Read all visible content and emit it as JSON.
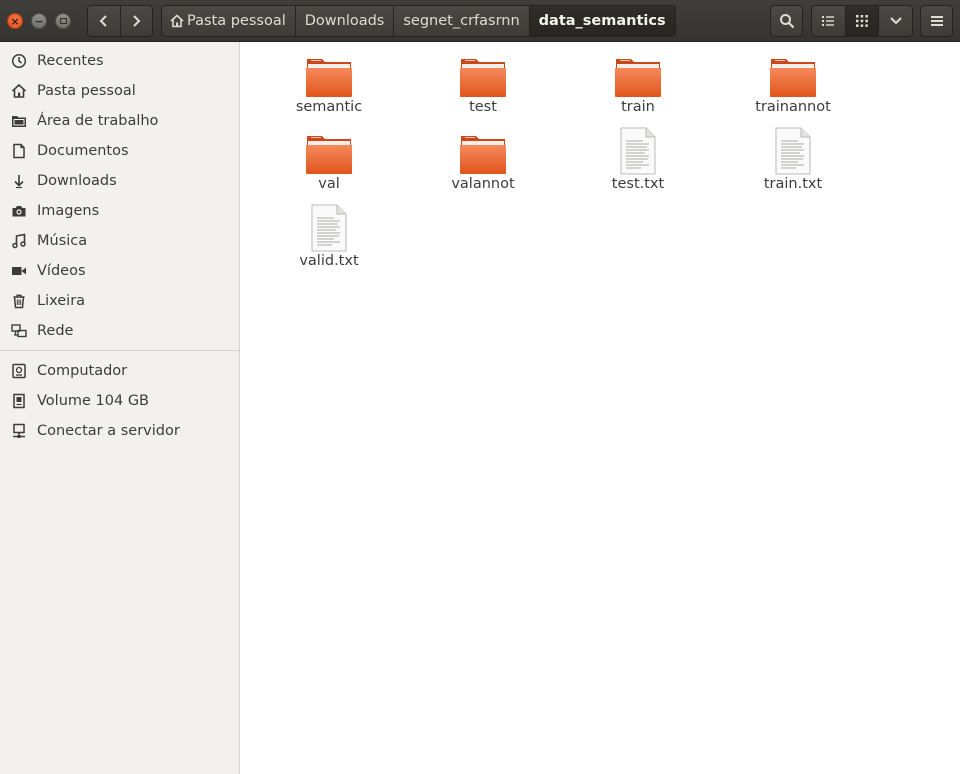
{
  "window": {
    "close_symbol": "×",
    "minimize_symbol": "−"
  },
  "breadcrumb": [
    {
      "label": "Pasta pessoal",
      "icon": "home-icon"
    },
    {
      "label": "Downloads"
    },
    {
      "label": "segnet_crfasrnn"
    },
    {
      "label": "data_semantics",
      "active": true
    }
  ],
  "sidebar": {
    "places": [
      {
        "label": "Recentes",
        "icon": "clock-icon"
      },
      {
        "label": "Pasta pessoal",
        "icon": "home-icon"
      },
      {
        "label": "Área de trabalho",
        "icon": "desktop-folder-icon"
      },
      {
        "label": "Documentos",
        "icon": "document-icon"
      },
      {
        "label": "Downloads",
        "icon": "download-icon"
      },
      {
        "label": "Imagens",
        "icon": "camera-icon"
      },
      {
        "label": "Música",
        "icon": "music-icon"
      },
      {
        "label": "Vídeos",
        "icon": "video-icon"
      },
      {
        "label": "Lixeira",
        "icon": "trash-icon"
      },
      {
        "label": "Rede",
        "icon": "network-icon"
      }
    ],
    "devices": [
      {
        "label": "Computador",
        "icon": "computer-icon"
      },
      {
        "label": "Volume 104 GB",
        "icon": "drive-icon"
      },
      {
        "label": "Conectar a servidor",
        "icon": "server-icon"
      }
    ]
  },
  "files": [
    {
      "name": "semantic",
      "type": "folder"
    },
    {
      "name": "test",
      "type": "folder"
    },
    {
      "name": "train",
      "type": "folder"
    },
    {
      "name": "trainannot",
      "type": "folder"
    },
    {
      "name": "val",
      "type": "folder"
    },
    {
      "name": "valannot",
      "type": "folder"
    },
    {
      "name": "test.txt",
      "type": "text"
    },
    {
      "name": "train.txt",
      "type": "text"
    },
    {
      "name": "valid.txt",
      "type": "text"
    }
  ],
  "colors": {
    "header": "#3c3b37",
    "close_button": "#e95420",
    "folder_orange": "#e95420",
    "sidebar_bg": "#f2f1f0"
  }
}
